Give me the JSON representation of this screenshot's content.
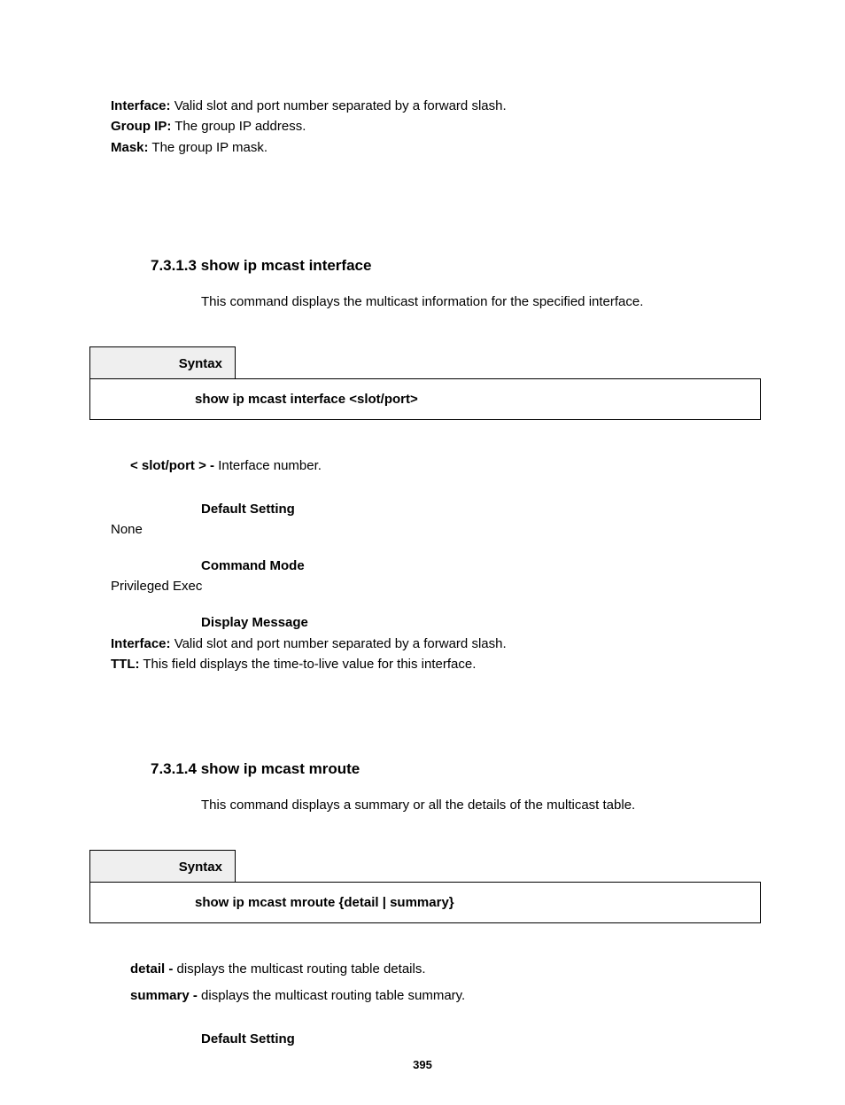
{
  "top_definitions": {
    "interface_label": "Interface:",
    "interface_text": " Valid slot and port number separated by a forward slash.",
    "groupip_label": "Group IP:",
    "groupip_text": " The group IP address.",
    "mask_label": "Mask:",
    "mask_text": " The group IP mask."
  },
  "section1": {
    "number": "7.3.1.3 ",
    "title": "show ip mcast interface",
    "description": "This command displays the multicast information for the specified interface.",
    "syntax_label": "Syntax",
    "syntax_body": "show ip mcast interface <slot/port>",
    "param_label": "< slot/port > - ",
    "param_text": "Interface number.",
    "default_setting_label": "Default Setting",
    "default_setting_value": "None",
    "command_mode_label": "Command Mode",
    "command_mode_value": "Privileged Exec",
    "display_message_label": "Display Message",
    "dm_interface_label": "Interface:",
    "dm_interface_text": " Valid slot and port number separated by a forward slash.",
    "dm_ttl_label": "TTL:",
    "dm_ttl_text": " This field displays the time-to-live value for this interface."
  },
  "section2": {
    "number": "7.3.1.4 ",
    "title": "show ip mcast mroute",
    "description": "This command displays a summary or all the details of the multicast table.",
    "syntax_label": "Syntax",
    "syntax_body": "show ip mcast mroute {detail | summary}",
    "param1_label": "detail - ",
    "param1_text": "displays the multicast routing table details.",
    "param2_label": "summary - ",
    "param2_text": "displays the multicast routing table summary.",
    "default_setting_label": "Default Setting"
  },
  "page_number": "395"
}
